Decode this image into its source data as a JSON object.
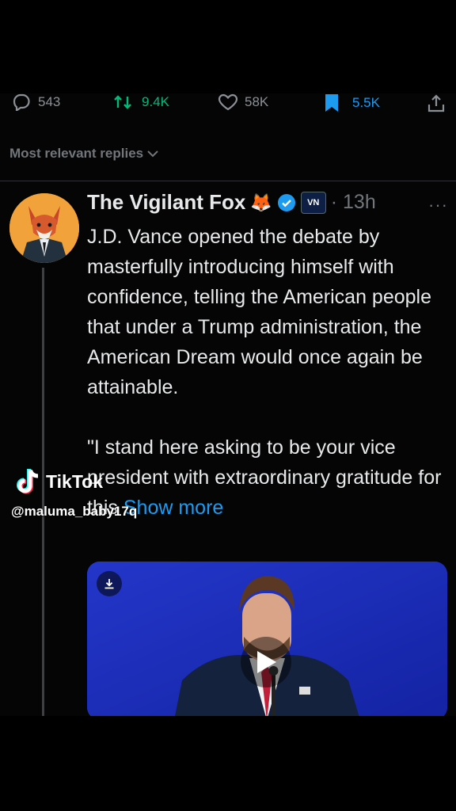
{
  "stats": {
    "replies": "543",
    "reposts": "9.4K",
    "likes": "58K",
    "bookmarks": "5.5K"
  },
  "sort_label": "Most relevant replies",
  "tweet": {
    "author": "The Vigilant Fox",
    "fox_emoji": "🦊",
    "affiliate_badge": "VN",
    "time": "· 13h",
    "more": "···",
    "text": "J.D. Vance opened the debate by masterfully introducing himself with confidence, telling the American people that under a Trump administration, the American Dream would once again be attainable.\n\n\"I stand here asking to be your vice president with extraordinary gratitude for this ",
    "show_more": "Show more"
  },
  "watermark": {
    "brand": "TikTok",
    "handle": "@maluma_baby17q"
  },
  "colors": {
    "accent": "#1d9bf0",
    "repost": "#00ba7c",
    "muted": "#71767b",
    "background": "#000000"
  },
  "icons": [
    "reply-icon",
    "repost-icon",
    "like-icon",
    "bookmark-icon",
    "share-icon",
    "chevron-down-icon",
    "verified-badge-icon",
    "download-icon",
    "play-icon",
    "tiktok-logo-icon"
  ]
}
